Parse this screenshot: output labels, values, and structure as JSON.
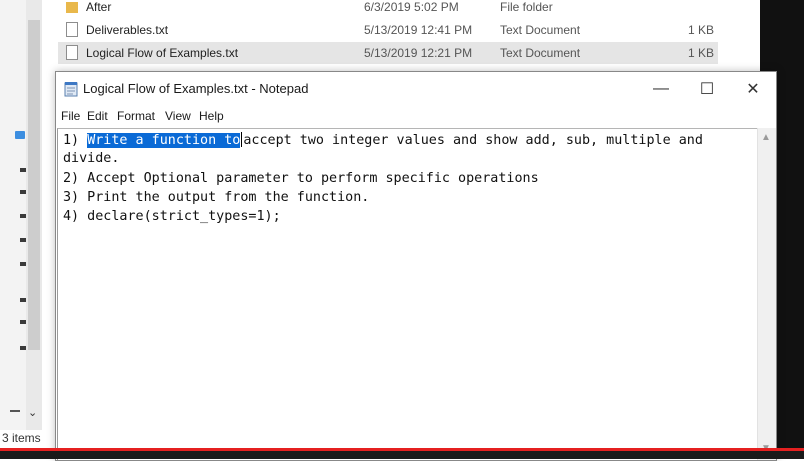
{
  "explorer": {
    "files": [
      {
        "icon": "folder-icon",
        "name": "After",
        "date": "6/3/2019 5:02 PM",
        "type": "File folder",
        "size": ""
      },
      {
        "icon": "text-file-icon",
        "name": "Deliverables.txt",
        "date": "5/13/2019 12:41 PM",
        "type": "Text Document",
        "size": "1 KB"
      },
      {
        "icon": "text-file-icon",
        "name": "Logical Flow of Examples.txt",
        "date": "5/13/2019 12:21 PM",
        "type": "Text Document",
        "size": "1 KB"
      }
    ],
    "item_count": "3 items"
  },
  "notepad": {
    "title": "Logical Flow of Examples.txt - Notepad",
    "window_controls": {
      "minimize": "—",
      "maximize": "☐",
      "close": "✕"
    },
    "menu": [
      "File",
      "Edit",
      "Format",
      "View",
      "Help"
    ],
    "content": {
      "line1_prefix": "1) ",
      "line1_selected": "Write a function to",
      "line1_rest": "accept two integer values and show add, sub, multiple and",
      "line1_wrap": "divide.",
      "line2": "2) Accept Optional parameter to perform specific operations",
      "line3": "3) Print the output from the function.",
      "line4": "4) declare(strict_types=1);"
    },
    "scrollbar": {
      "up": "▲",
      "down": "▼"
    }
  },
  "colors": {
    "selection": "#0a6ad6",
    "accent_red": "#e52020"
  }
}
